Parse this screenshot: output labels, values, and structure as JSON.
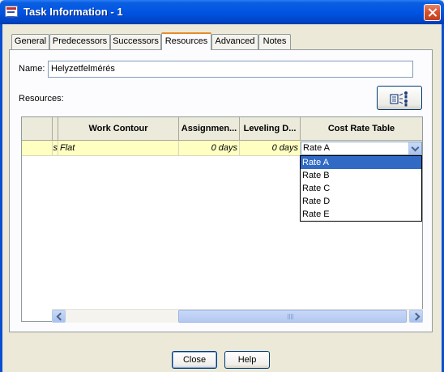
{
  "window": {
    "title": "Task Information - 1"
  },
  "tabs": [
    {
      "label": "General"
    },
    {
      "label": "Predecessors"
    },
    {
      "label": "Successors"
    },
    {
      "label": "Resources",
      "active": true
    },
    {
      "label": "Advanced"
    },
    {
      "label": "Notes"
    }
  ],
  "form": {
    "name_label": "Name:",
    "name_value": "Helyzetfelmérés",
    "resources_label": "Resources:"
  },
  "table": {
    "columns": [
      "",
      "",
      "Work Contour",
      "Assignmen...",
      "Leveling D...",
      "Cost Rate Table"
    ],
    "rows": [
      {
        "col_a": "",
        "col_b": "s",
        "work_contour": "Flat",
        "assignment_delay": "0 days",
        "leveling_delay": "0 days",
        "cost_rate_table": "Rate A"
      }
    ]
  },
  "cost_rate_dropdown": {
    "selected": "Rate A",
    "options": [
      "Rate A",
      "Rate B",
      "Rate C",
      "Rate D",
      "Rate E"
    ]
  },
  "buttons": {
    "close": "Close",
    "help": "Help"
  },
  "colors": {
    "titlebar": "#0054e3",
    "row_highlight": "#ffffc2",
    "selection": "#316ac5",
    "active_tab_accent": "#e68b2c"
  },
  "icons": {
    "window": "app-icon",
    "close": "close-icon",
    "assign": "assign-resources-icon"
  }
}
